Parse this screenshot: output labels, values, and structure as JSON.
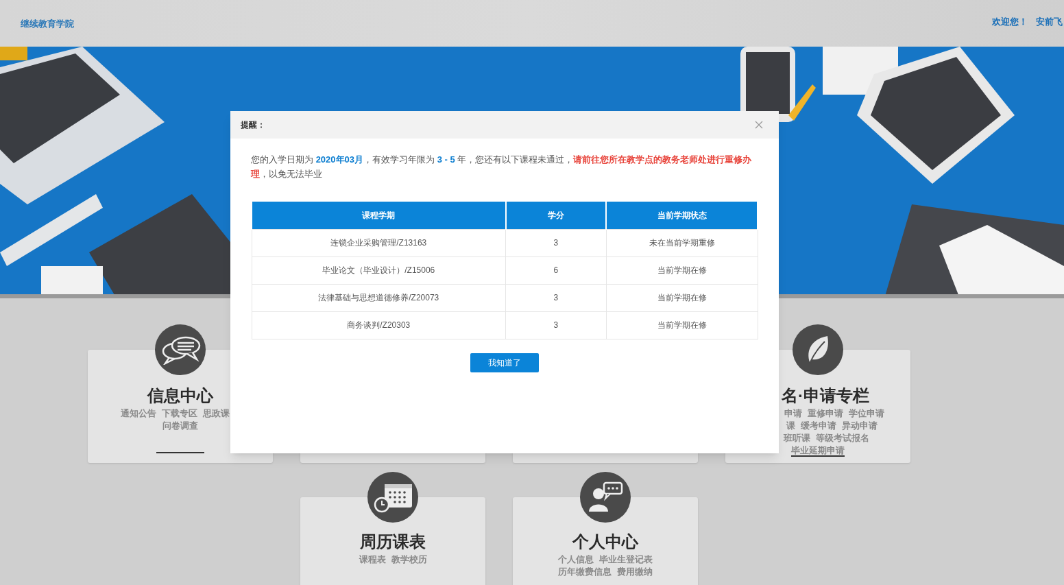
{
  "header": {
    "logo": "继续教育学院",
    "welcome": "欢迎您！",
    "user": "安前飞"
  },
  "cards": [
    {
      "kind": "chat",
      "title": "信息中心",
      "links": [
        [
          "通知公告",
          "下载专区",
          "思政课"
        ],
        [
          "问卷调查"
        ]
      ]
    },
    {
      "kind": "covered"
    },
    {
      "kind": "covered"
    },
    {
      "kind": "leaf",
      "title": "名·申请专栏",
      "links": [
        [
          "申请",
          "重修申请",
          "学位申请"
        ],
        [
          "课",
          "缓考申请",
          "异动申请"
        ],
        [
          "班听课",
          "等级考试报名"
        ],
        [
          "毕业延期申请"
        ]
      ]
    },
    {
      "kind": "calendar",
      "title": "周历课表",
      "links": [
        [
          "课程表",
          "教学校历"
        ]
      ]
    },
    {
      "kind": "person",
      "title": "个人中心",
      "links": [
        [
          "个人信息",
          "毕业生登记表"
        ],
        [
          "历年缴费信息",
          "费用缴纳"
        ]
      ]
    }
  ],
  "dialog": {
    "title": "提醒：",
    "message": [
      {
        "kind": "plain",
        "text": "您的入学日期为 "
      },
      {
        "kind": "highlight",
        "text": "2020年03月"
      },
      {
        "kind": "plain",
        "text": "，有效学习年限为 "
      },
      {
        "kind": "highlight",
        "text": "3 - 5"
      },
      {
        "kind": "plain",
        "text": " 年，您还有以下课程未通过，"
      },
      {
        "kind": "warning",
        "text": "请前往您所在教学点的教务老师处进行重修办理"
      },
      {
        "kind": "plain",
        "text": "，以免无法毕业"
      }
    ],
    "table": {
      "columns": [
        "课程学期",
        "学分",
        "当前学期状态"
      ],
      "rows": [
        [
          "连锁企业采购管理/Z13163",
          "3",
          "未在当前学期重修"
        ],
        [
          "毕业论文（毕业设计）/Z15006",
          "6",
          "当前学期在修"
        ],
        [
          "法律基础与思想道德修养/Z20073",
          "3",
          "当前学期在修"
        ],
        [
          "商务谈判/Z20303",
          "3",
          "当前学期在修"
        ]
      ]
    },
    "button": "我知道了"
  }
}
